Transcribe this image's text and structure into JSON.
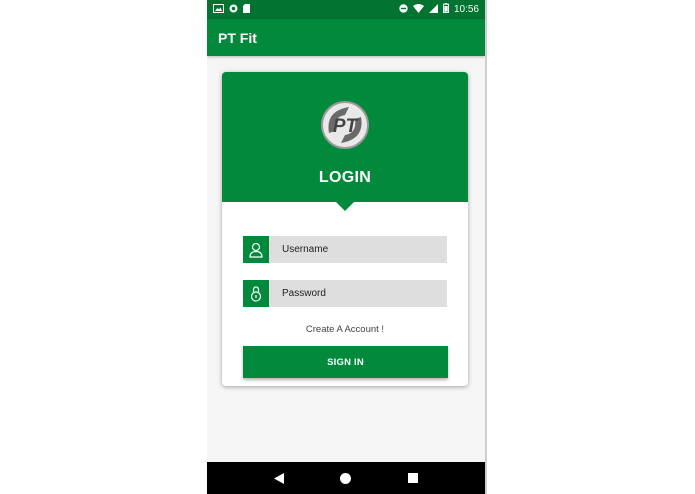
{
  "status_bar": {
    "time": "10:56",
    "left_icons": [
      "image-icon",
      "record-icon",
      "sd-card-icon"
    ],
    "right_icons": [
      "do-not-disturb-icon",
      "wifi-icon",
      "signal-icon",
      "battery-icon"
    ]
  },
  "app_bar": {
    "title": "PT Fit"
  },
  "login_card": {
    "logo_text": "PT",
    "title": "LOGIN",
    "username": {
      "value": "",
      "placeholder": "Username",
      "icon": "user-icon"
    },
    "password": {
      "value": "",
      "placeholder": "Password",
      "icon": "lock-icon"
    },
    "create_account_label": "Create A Account !",
    "sign_in_label": "SIGN IN"
  },
  "nav_bar": {
    "buttons": [
      "back-icon",
      "home-icon",
      "recents-icon"
    ]
  },
  "colors": {
    "primary": "#02893b",
    "primary_dark": "#027331",
    "field_bg": "#dedede",
    "background": "#f5f5f5"
  }
}
